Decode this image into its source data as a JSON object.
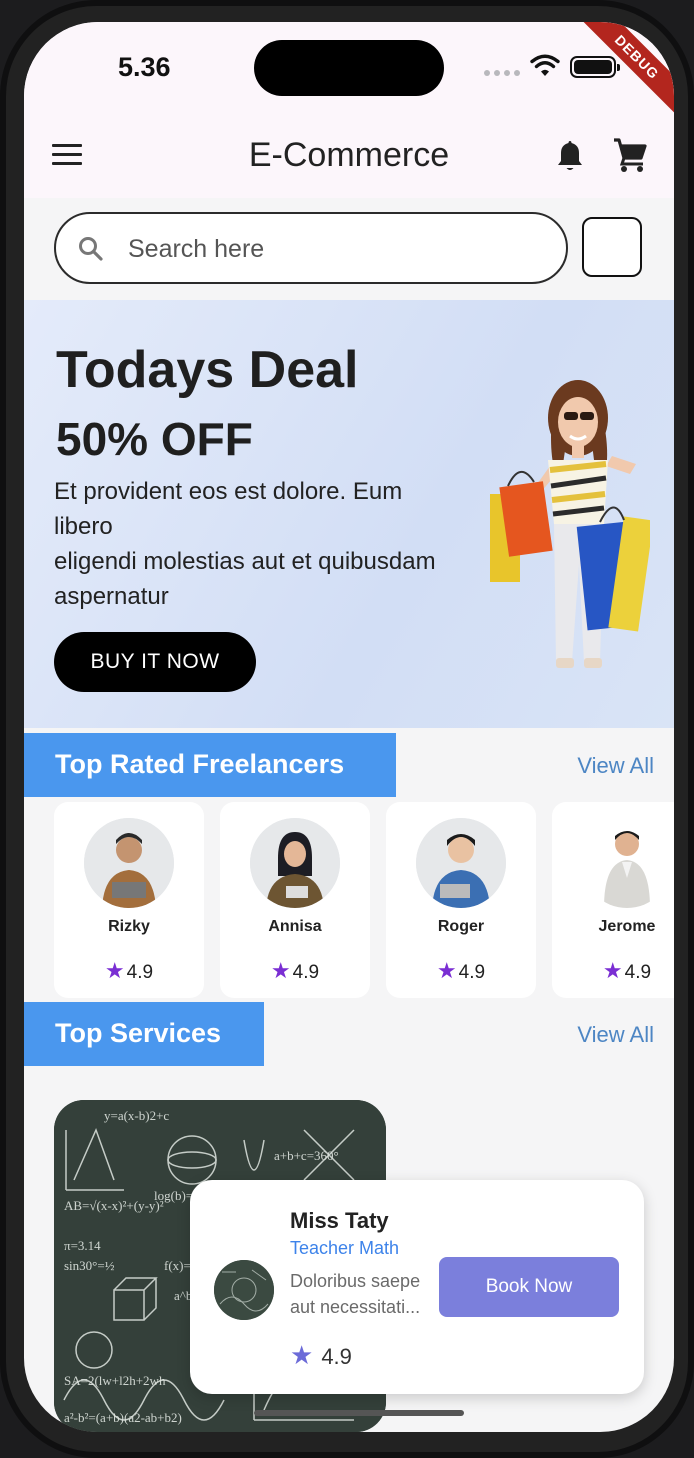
{
  "status": {
    "time": "5.36",
    "debug_label": "DEBUG"
  },
  "appbar": {
    "title": "E-Commerce"
  },
  "search": {
    "placeholder": "Search here"
  },
  "banner": {
    "title": "Todays Deal",
    "discount": "50% OFF",
    "description_lines": [
      "Et provident eos est dolore. Eum",
      "libero",
      "eligendi molestias aut et quibusdam",
      "aspernatur"
    ],
    "button_label": "BUY IT NOW"
  },
  "freelancers": {
    "section_title": "Top Rated Freelancers",
    "view_all": "View All",
    "items": [
      {
        "name": "Rizky",
        "rating": "4.9"
      },
      {
        "name": "Annisa",
        "rating": "4.9"
      },
      {
        "name": "Roger",
        "rating": "4.9"
      },
      {
        "name": "Jerome",
        "rating": "4.9"
      }
    ]
  },
  "services": {
    "section_title": "Top Services",
    "view_all": "View All",
    "featured": {
      "name": "Miss Taty",
      "role": "Teacher Math",
      "desc_lines": [
        "Doloribus saepe",
        "aut necessitati..."
      ],
      "rating": "4.9",
      "button_label": "Book Now"
    }
  },
  "colors": {
    "section_tag": "#4a97ee",
    "view_all": "#4d86c4",
    "star_freelancer": "#7a2ed3",
    "book_button": "#7b7fdc",
    "role_text": "#3d83ea"
  }
}
